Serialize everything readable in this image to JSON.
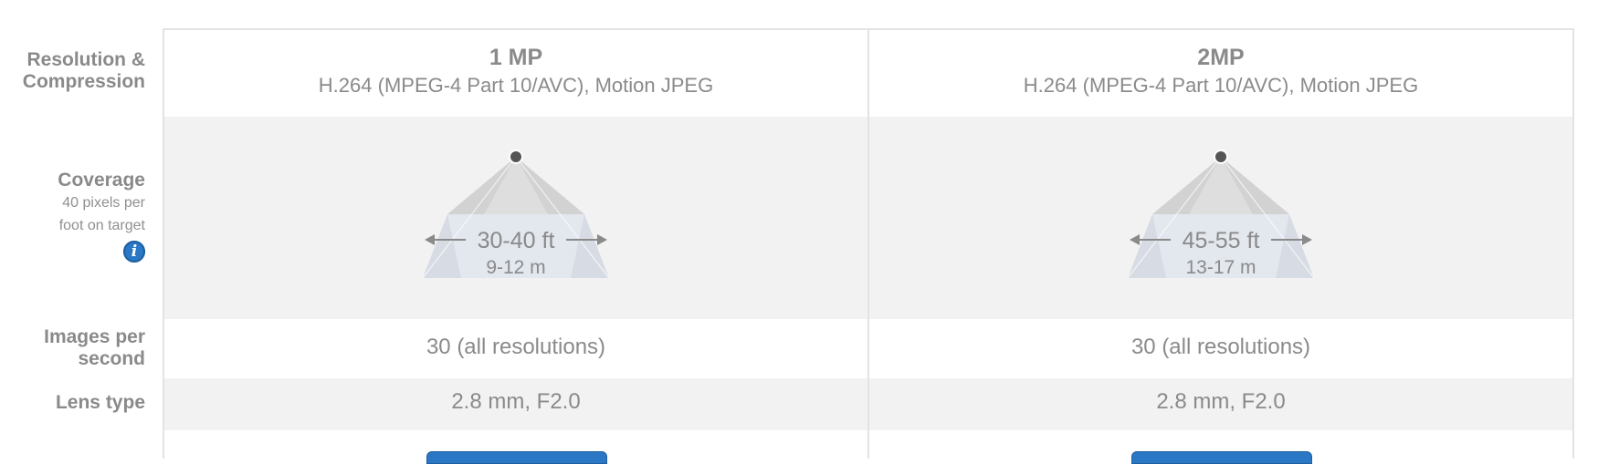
{
  "labels": {
    "resolution_line1": "Resolution &",
    "resolution_line2": "Compression",
    "coverage": "Coverage",
    "coverage_sub1": "40 pixels per",
    "coverage_sub2": "foot on target",
    "info_glyph": "i",
    "images_line1": "Images per",
    "images_line2": "second",
    "lens": "Lens type"
  },
  "columns": [
    {
      "resolution": "1 MP",
      "compression": "H.264 (MPEG-4 Part 10/AVC), Motion JPEG",
      "coverage_ft": "30-40 ft",
      "coverage_m": "9-12 m",
      "images_per_second": "30 (all resolutions)",
      "lens_type": "2.8 mm, F2.0"
    },
    {
      "resolution": "2MP",
      "compression": "H.264 (MPEG-4 Part 10/AVC), Motion JPEG",
      "coverage_ft": "45-55 ft",
      "coverage_m": "13-17 m",
      "images_per_second": "30 (all resolutions)",
      "lens_type": "2.8 mm, F2.0"
    }
  ],
  "colors": {
    "info_icon": "#2a78c5",
    "button": "#2a78c5",
    "row_band": "#f2f2f2",
    "text": "#8a8a8a"
  },
  "icons": {
    "info": "info-icon",
    "coverage": "camera-coverage-diagram"
  }
}
